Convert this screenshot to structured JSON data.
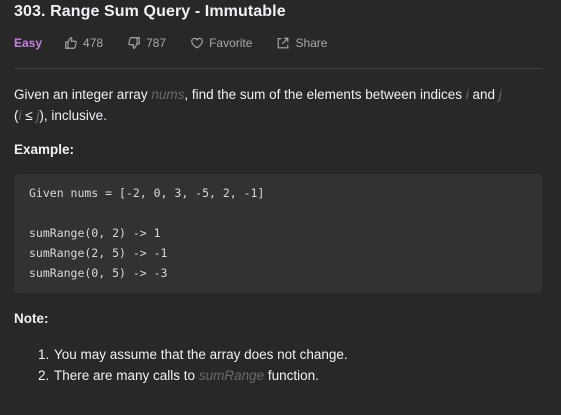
{
  "problem": {
    "title": "303. Range Sum Query - Immutable",
    "difficulty": "Easy",
    "likes": "478",
    "dislikes": "787",
    "favorite_label": "Favorite",
    "share_label": "Share"
  },
  "description": {
    "p1": "Given an integer array ",
    "nums_var": "nums",
    "p2": ", find the sum of the elements between indices ",
    "i_var": "i",
    "p3": " and ",
    "j_var": "j",
    "p4": "(",
    "i_var2": "i",
    "le": " ≤ ",
    "j_var2": "j",
    "p5": "), inclusive."
  },
  "example": {
    "heading": "Example:",
    "lines": [
      "Given nums = [-2, 0, 3, -5, 2, -1]",
      "",
      "sumRange(0, 2) -> 1",
      "sumRange(2, 5) -> -1",
      "sumRange(0, 5) -> -3"
    ]
  },
  "notes": {
    "heading": "Note:",
    "items": [
      {
        "num": "1.",
        "text": "You may assume that the array does not change."
      },
      {
        "num": "2.",
        "pre": "There are many calls to ",
        "var": "sumRange",
        "post": " function."
      }
    ]
  },
  "colors": {
    "background": "#282828",
    "difficulty_easy": "#c77fdd",
    "code_background": "#323232"
  }
}
